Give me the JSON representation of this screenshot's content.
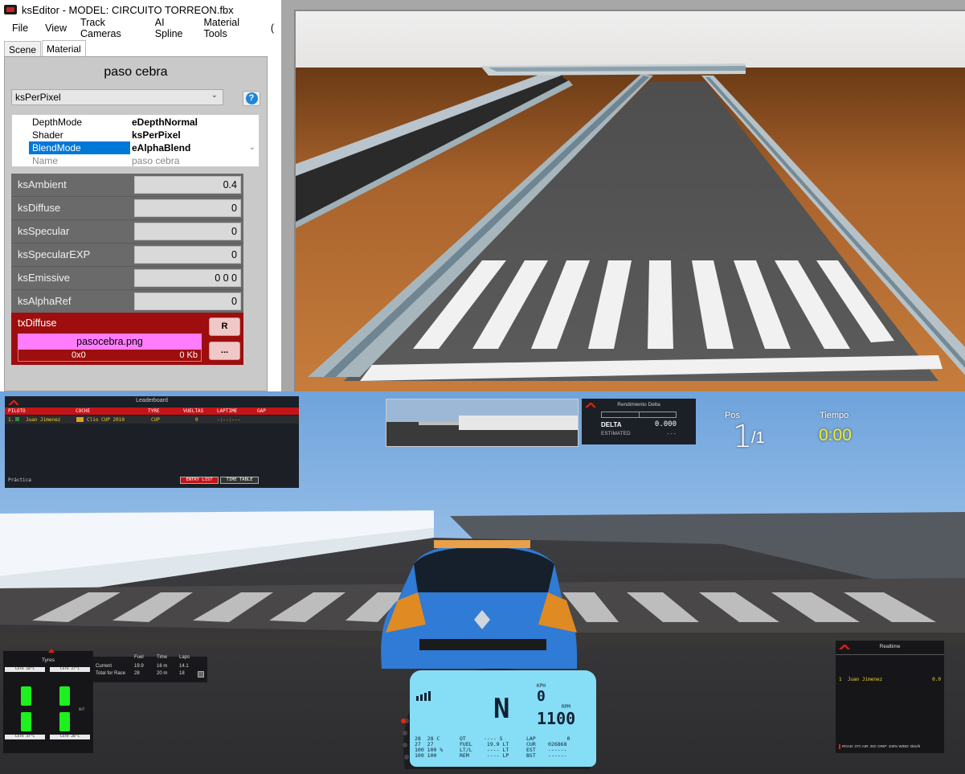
{
  "editor": {
    "window_title": "ksEditor - MODEL: CIRCUITO TORREON.fbx",
    "menu": [
      "File",
      "View",
      "Track Cameras",
      "AI Spline",
      "Material Tools",
      "("
    ],
    "tabs": [
      "Scene",
      "Material"
    ],
    "active_tab": "Material",
    "material_name": "paso cebra",
    "shader_select": "ksPerPixel",
    "properties": [
      {
        "key": "DepthMode",
        "value": "eDepthNormal"
      },
      {
        "key": "Shader",
        "value": "ksPerPixel"
      },
      {
        "key": "BlendMode",
        "value": "eAlphaBlend"
      },
      {
        "key": "Name",
        "value": "paso cebra"
      }
    ],
    "params": [
      {
        "label": "ksAmbient",
        "value": "0.4"
      },
      {
        "label": "ksDiffuse",
        "value": "0"
      },
      {
        "label": "ksSpecular",
        "value": "0"
      },
      {
        "label": "ksSpecularEXP",
        "value": "0"
      },
      {
        "label": "ksEmissive",
        "value": "0 0 0"
      },
      {
        "label": "ksAlphaRef",
        "value": "0"
      }
    ],
    "texture": {
      "slot": "txDiffuse",
      "file": "pasocebra.png",
      "dims": "0x0",
      "size": "0 Kb",
      "reload_label": "R",
      "browse_label": "..."
    },
    "icons": {
      "help": "help-icon",
      "dropdown": "chevron-down-icon"
    }
  },
  "game": {
    "leaderboard": {
      "title": "Leaderboard",
      "columns": [
        "PILOTO",
        "COCHE",
        "TYRE",
        "VUELTAS",
        "LAPTIME",
        "GAP"
      ],
      "rows": [
        {
          "pos": "1.",
          "driver": "Juan Jimenez",
          "car": "Clio CUP 2010",
          "tyre": "CUP",
          "laps": "0",
          "laptime": "-:--:---",
          "gap": ""
        }
      ],
      "session": "Práctica",
      "buttons": [
        "ENTRY LIST",
        "TIME TABLE"
      ]
    },
    "delta": {
      "title": "Rendimiento Delta",
      "delta_label": "DELTA",
      "delta_value": "0.000",
      "estimated_label": "ESTIMATED",
      "estimated_value": "---"
    },
    "position": {
      "label": "Pos",
      "current": "1",
      "total": "/1"
    },
    "time": {
      "label": "Tiempo",
      "value": "0:00"
    },
    "tyres": {
      "title": "Tyres",
      "front_left_core": "Core 18°C",
      "front_right_core": "Core 27°C",
      "rear_left_core": "Core 37°C",
      "rear_right_core": "Core 28°C",
      "bias_label": "OUT"
    },
    "fuel": {
      "headers": [
        "Fuel",
        "Time",
        "Laps"
      ],
      "rows": [
        {
          "label": "Current",
          "fuel": "19.9",
          "time": "16 m",
          "laps": "14.1"
        },
        {
          "label": "Total for Race",
          "fuel": "28",
          "time": "20 m",
          "laps": "18"
        }
      ]
    },
    "realtime": {
      "title": "Realtime",
      "rows": [
        {
          "pos": "1",
          "driver": "Juan Jimenez",
          "value": "0.0"
        }
      ],
      "footer": "ROAD: 37C AIR: 26C GRIP: 100% WIND: 0km/h"
    },
    "dash": {
      "gear": "N",
      "kph_label": "KPH",
      "speed": "0",
      "rpm_label": "RPM",
      "rpm": "1100",
      "left_block": "28  28 C\n27  27\n100 100 %\n100 100",
      "mid_labels": "OT\nFUEL\nLT/L\nREM",
      "mid_values": "---- S\n 19.9 LT\n ---- LT\n ---- LP",
      "right_labels": "LAP\nCUR\nEST\nBST",
      "right_values": "      0\n026868\n------\n------"
    }
  },
  "colors": {
    "panel_gray": "#c9c9c9",
    "param_row": "#6a6a6a",
    "texture_red": "#9e0e0e",
    "texture_pink": "#ff7cff",
    "select_blue": "#0078d7",
    "lcd_blue": "#86ddf6",
    "hud_red": "#c41418",
    "hud_yellow": "#f2d02a",
    "time_yellow": "#f0f020"
  }
}
